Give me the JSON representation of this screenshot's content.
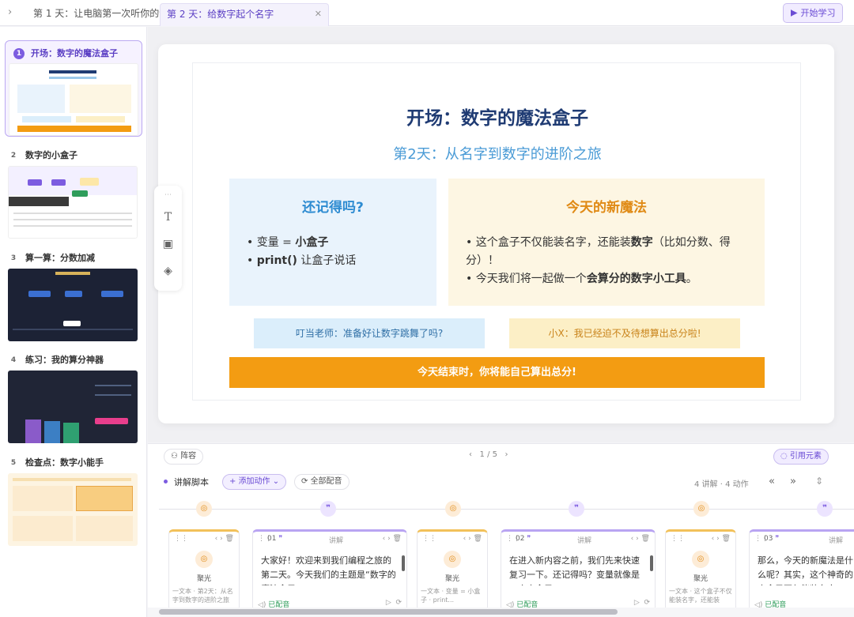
{
  "tabs": {
    "tab1": "第 1 天：让电脑第一次听你的话",
    "tab2": "第 2 天：给数字起个名字",
    "start_label": "开始学习"
  },
  "sidebar": {
    "items": [
      {
        "num": "1",
        "label": "开场：数字的魔法盒子"
      },
      {
        "num": "2",
        "label": "数字的小盒子"
      },
      {
        "num": "3",
        "label": "算一算：分数加减"
      },
      {
        "num": "4",
        "label": "练习：我的算分神器"
      },
      {
        "num": "5",
        "label": "检查点：数字小能手"
      }
    ]
  },
  "slide": {
    "title": "开场：数字的魔法盒子",
    "subtitle": "第2天：从名字到数字的进阶之旅",
    "left_box": {
      "heading": "还记得吗?",
      "item1_a": "变量 = ",
      "item1_b": "小盒子",
      "item2_a": "print()",
      "item2_b": " 让盒子说话"
    },
    "right_box": {
      "heading": "今天的新魔法",
      "item1_a": "这个盒子不仅能装名字，还能装",
      "item1_b": "数字",
      "item1_c": "（比如分数、得分）！",
      "item2_a": "今天我们将一起做一个",
      "item2_b": "会算分的数字小工具",
      "item2_c": "。"
    },
    "note_left": "叮当老师：准备好让数字跳舞了吗?",
    "note_right": "小X：我已经迫不及待想算出总分啦!",
    "banner": "今天结束时，你将能自己算出总分!"
  },
  "bottom": {
    "scene_label": "阵容",
    "pager": "1 / 5",
    "quote_label": "引用元素",
    "script_label": "讲解脚本",
    "add_action": "添加动作",
    "all_dub": "全部配音",
    "stats": "4 讲解 · 4 动作",
    "cards": [
      {
        "type": "action",
        "title": "聚光",
        "desc": "一文本 · 第2天：从名字到数字的进阶之旅"
      },
      {
        "type": "speech",
        "id": "01",
        "role": "讲解",
        "text": "大家好！欢迎来到我们编程之旅的第二天。今天我们的主题是“数字的魔法盒子”。",
        "status": "已配音"
      },
      {
        "type": "action",
        "title": "聚光",
        "desc": "一文本 · 变量 = 小盒子 · print..."
      },
      {
        "type": "speech",
        "id": "02",
        "role": "讲解",
        "text": "在进入新内容之前，我们先来快速复习一下。还记得吗？变量就像是一个小盒子。",
        "status": "已配音"
      },
      {
        "type": "action",
        "title": "聚光",
        "desc": "一文本 · 这个盒子不仅能装名字，还能装"
      },
      {
        "type": "speech",
        "id": "03",
        "role": "讲解",
        "text": "那么，今天的新魔法是什么呢？其实，这个神奇的小盒子不仅能装名字。",
        "status": "已配音"
      }
    ]
  }
}
